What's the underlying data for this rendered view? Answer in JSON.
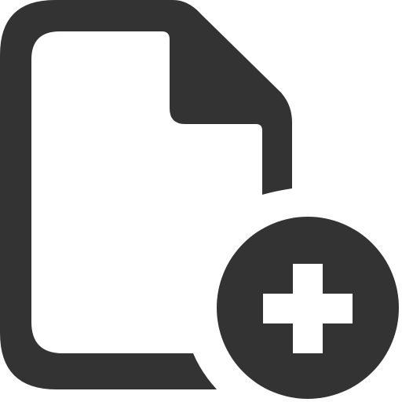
{
  "icon": {
    "semantic": "file-add-icon",
    "parts": {
      "document": "document-icon",
      "badge": "plus-badge-icon",
      "plus": "plus-icon"
    }
  },
  "colors": {
    "ink": "#333333",
    "background": "#ffffff",
    "plus": "#ffffff"
  }
}
